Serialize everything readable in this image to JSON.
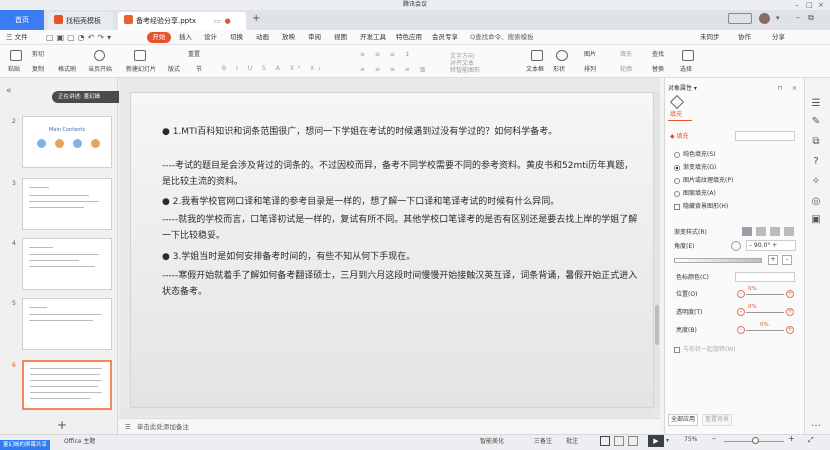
{
  "meeting": {
    "title": "腾讯会议"
  },
  "tabs": {
    "home": "首页",
    "template": "找稻壳模板",
    "doc": "备考经验分享.pptx",
    "add": "+"
  },
  "menu": {
    "file": "三 文件",
    "items": [
      "开始",
      "插入",
      "设计",
      "切换",
      "动画",
      "放映",
      "审阅",
      "视图",
      "开发工具",
      "特色应用",
      "会员专享"
    ],
    "search": "Q查找命令、搜索模板",
    "right": [
      "未同步",
      "协作",
      "分享"
    ]
  },
  "toolbar": {
    "paste": "粘贴",
    "cut": "剪切",
    "copy": "复制",
    "format_painter": "格式刷",
    "from_current": "当页开始",
    "new_slide": "新建幻灯片",
    "layout": "版式",
    "section": "节",
    "reset": "重置",
    "textbox": "文本框",
    "shape": "形状",
    "picture": "图片",
    "fill": "填充",
    "arrange": "排列",
    "outline": "轮廓",
    "find": "查找",
    "replace": "替换",
    "select": "选择",
    "text_direction": "文字方向",
    "align_text": "对齐文本",
    "smart_art": "转智能图形"
  },
  "overlay": {
    "text": "正在讲述: 董幻嫣"
  },
  "thumbnails": [
    {
      "num": "2",
      "title": "Main Contents"
    },
    {
      "num": "3",
      "title": ""
    },
    {
      "num": "4",
      "title": ""
    },
    {
      "num": "5",
      "title": ""
    },
    {
      "num": "6",
      "title": ""
    }
  ],
  "slide": {
    "p1": "● 1.MTI百科知识和词条范围很广，想问一下学姐在考试的时候遇到过没有学过的？如何科学备考。",
    "p2": "----考试的题目是会涉及背过的词条的。不过因校而异，备考不同学校需要不同的参考资料。黄皮书和52mti历年真题，是比较主流的资料。",
    "p3": "● 2.我看学校官网口译和笔译的参考目录是一样的，想了解一下口译和笔译考试的时候有什么异同。",
    "p4": "-----就我的学校而言，口笔译初试是一样的，复试有所不同。其他学校口笔译考的是否有区别还是要去找上岸的学姐了解一下比较稳妥。",
    "p5": "● 3.学姐当时是如何安排备考时间的，有些不知从何下手现在。",
    "p6": "-----寒假开始就着手了解如何备考翻译硕士，三月到六月这段时间慢慢开始接触汉英互译，词条背诵，暑假开始正式进入状态备考。"
  },
  "notes": {
    "placeholder": "单击此处添加备注"
  },
  "panel": {
    "title": "对象属性 ▾",
    "tab": "填充",
    "fill_header": "◆ 填充",
    "options": [
      "纯色填充(S)",
      "渐变填充(G)",
      "图片或纹理填充(P)",
      "图案填充(A)",
      "隐藏背景图形(H)"
    ],
    "gradient_style": "渐变样式(R)",
    "angle_label": "角度(E)",
    "angle_value": "90.0°",
    "color_label": "色标颜色(C)",
    "position_label": "位置(O)",
    "transparency_label": "透明度(T)",
    "brightness_label": "亮度(B)",
    "pct": "0%",
    "rotate_with_shape": "与形状一起旋转(W)",
    "apply_all": "全部应用",
    "reset_bg": "重置背景"
  },
  "status": {
    "theme": "Office 主题",
    "beautify": "智能美化",
    "notes": "三备注",
    "comment": "批注",
    "zoom": "75%",
    "badge": "董幻嫣的屏幕共享"
  }
}
